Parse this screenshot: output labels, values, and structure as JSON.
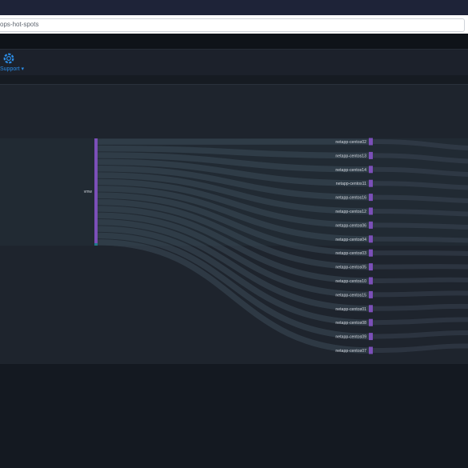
{
  "browser": {
    "url": "ops-hot-spots"
  },
  "header": {
    "support_label": "Support ▾",
    "support_icon": "lifebuoy-icon",
    "accent_color": "#2c8ee8"
  },
  "sankey": {
    "source": {
      "label": "vmw",
      "color": "#7b4fb8"
    },
    "targets": [
      {
        "label": "netapp-centos02"
      },
      {
        "label": "netapp-centos13"
      },
      {
        "label": "netapp-centos14"
      },
      {
        "label": "netapp-centos11"
      },
      {
        "label": "netapp-centos16"
      },
      {
        "label": "netapp-centos12"
      },
      {
        "label": "netapp-centos06"
      },
      {
        "label": "netapp-centos04"
      },
      {
        "label": "netapp-centos03"
      },
      {
        "label": "netapp-centos05"
      },
      {
        "label": "netapp-centos10"
      },
      {
        "label": "netapp-centos15"
      },
      {
        "label": "netapp-centos01"
      },
      {
        "label": "netapp-centos08"
      },
      {
        "label": "netapp-centos09"
      },
      {
        "label": "netapp-centos07"
      }
    ],
    "node_color": "#7b4fb8",
    "link_color": "#3d4a58"
  }
}
